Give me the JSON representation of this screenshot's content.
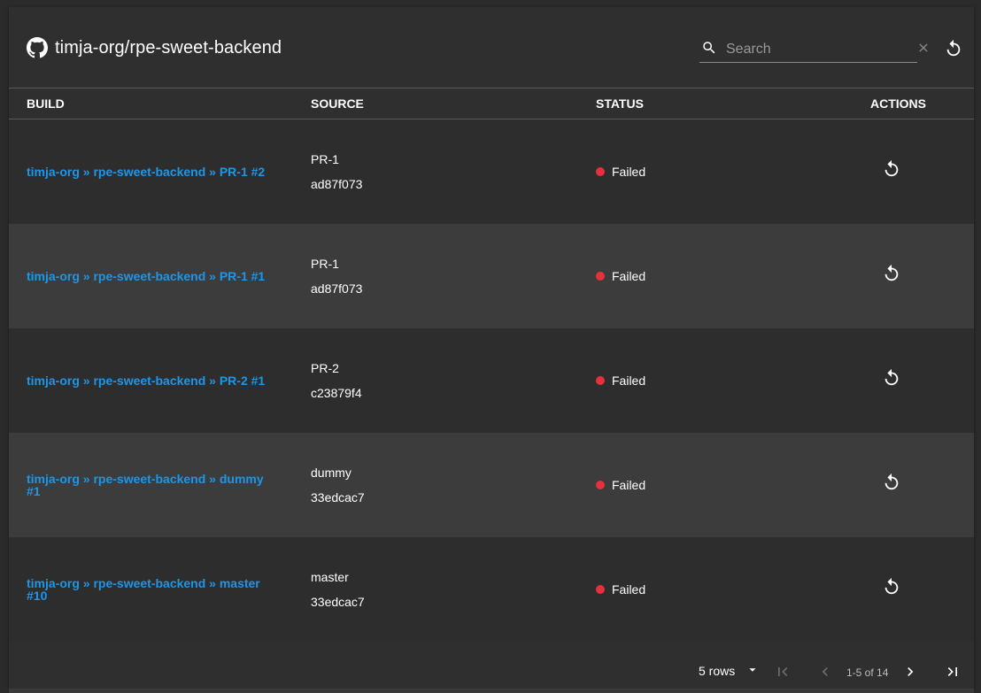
{
  "header": {
    "title": "timja-org/rpe-sweet-backend",
    "search_placeholder": "Search",
    "search_value": ""
  },
  "table": {
    "columns": [
      "BUILD",
      "SOURCE",
      "STATUS",
      "ACTIONS"
    ],
    "rows": [
      {
        "build": "timja-org » rpe-sweet-backend » PR-1 #2",
        "branch": "PR-1",
        "commit": "ad87f073",
        "status": "Failed"
      },
      {
        "build": "timja-org » rpe-sweet-backend » PR-1 #1",
        "branch": "PR-1",
        "commit": "ad87f073",
        "status": "Failed"
      },
      {
        "build": "timja-org » rpe-sweet-backend » PR-2 #1",
        "branch": "PR-2",
        "commit": "c23879f4",
        "status": "Failed"
      },
      {
        "build": "timja-org » rpe-sweet-backend » dummy #1",
        "branch": "dummy",
        "commit": "33edcac7",
        "status": "Failed"
      },
      {
        "build": "timja-org » rpe-sweet-backend » master #10",
        "branch": "master",
        "commit": "33edcac7",
        "status": "Failed"
      }
    ]
  },
  "pagination": {
    "rows_label": "5 rows",
    "range": "1-5 of 14"
  },
  "colors": {
    "link": "#1e96e8",
    "failed": "#e8303c",
    "background": "#2f2f2f"
  },
  "icons": [
    "github-icon",
    "search-icon",
    "close-icon",
    "refresh-icon",
    "replay-icon",
    "dropdown-arrow-icon",
    "first-page-icon",
    "prev-page-icon",
    "next-page-icon",
    "last-page-icon"
  ]
}
